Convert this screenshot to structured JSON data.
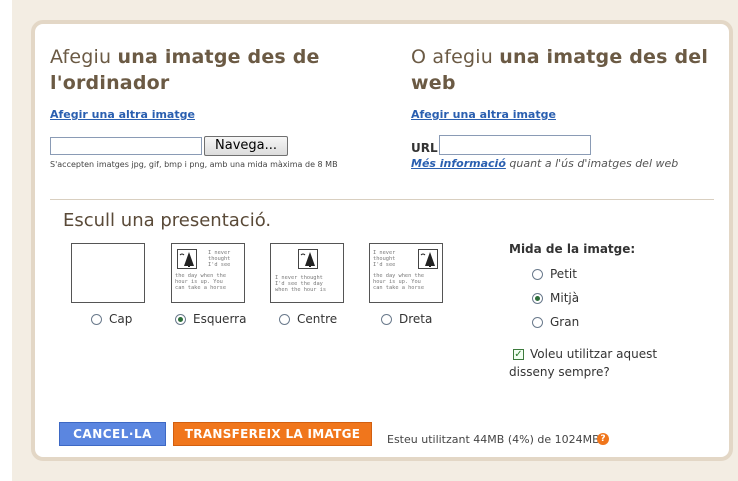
{
  "local": {
    "heading_part1": "Afegiu ",
    "heading_part2": "una imatge des de l'ordinador",
    "add_another": "Afegir una altra imatge",
    "browse_label": "Navega...",
    "file_value": "",
    "note": "S'accepten imatges jpg, gif, bmp i png, amb una mida màxima de 8 MB"
  },
  "web": {
    "heading_part1": "O afegiu ",
    "heading_part2": "una imatge des del web",
    "add_another": "Afegir una altra imatge",
    "url_label": "URL",
    "url_value": "",
    "more_info_link": "Més informació",
    "more_info_rest": " quant a l'ús d'imatges del web"
  },
  "layout": {
    "title": "Escull una presentació.",
    "options": [
      {
        "label": "Cap",
        "selected": false
      },
      {
        "label": "Esquerra",
        "selected": true
      },
      {
        "label": "Centre",
        "selected": false
      },
      {
        "label": "Dreta",
        "selected": false
      }
    ],
    "preview_left": [
      "I never",
      "thought",
      "I'd see",
      "the day when the",
      "hour is up. You",
      "can take a horse"
    ],
    "preview_center": [
      "I never thought",
      "I'd see the day",
      "when the hour is"
    ],
    "preview_right": [
      "I never",
      "thought",
      "I'd see",
      "the day when the",
      "hour is up. You",
      "can take a horse"
    ]
  },
  "size": {
    "title": "Mida de la imatge:",
    "options": [
      {
        "label": "Petit",
        "selected": false
      },
      {
        "label": "Mitjà",
        "selected": true
      },
      {
        "label": "Gran",
        "selected": false
      }
    ],
    "always_label_line1": "Voleu utilitzar aquest",
    "always_label_line2": "disseny sempre?",
    "always_checked": true
  },
  "footer": {
    "cancel_label": "CANCEL·LA",
    "upload_label": "TRANSFEREIX LA IMATGE",
    "usage_text": "Esteu utilitzant 44MB (4%) de 1024MB –",
    "help_icon": "question-icon",
    "help_glyph": "?"
  },
  "colors": {
    "cancel": "#5b86e0",
    "upload": "#f0761c",
    "link": "#2a5fb0",
    "frame": "#e3d7c6"
  }
}
